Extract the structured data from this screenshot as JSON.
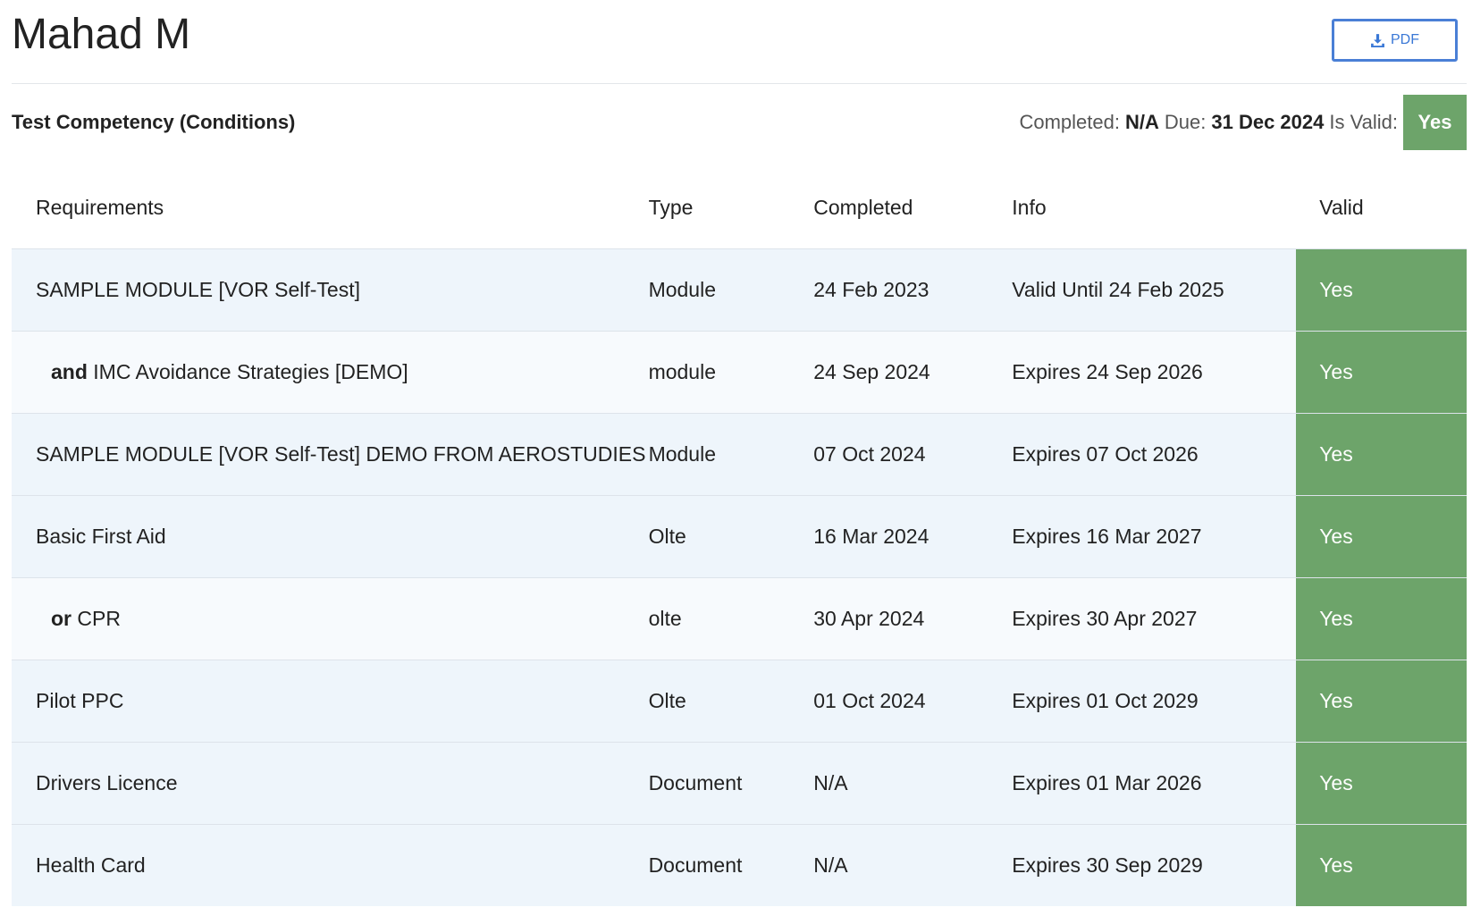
{
  "header": {
    "name": "Mahad M",
    "pdf_label": "PDF"
  },
  "summary": {
    "competency": "Test Competency (Conditions)",
    "completed_label": "Completed:",
    "completed_value": "N/A",
    "due_label": "Due:",
    "due_value": "31 Dec 2024",
    "valid_label": "Is Valid:",
    "valid_value": "Yes"
  },
  "table": {
    "columns": [
      "Requirements",
      "Type",
      "Completed",
      "Info",
      "Valid"
    ],
    "rows": [
      {
        "conj": "",
        "name": "SAMPLE MODULE [VOR Self-Test]",
        "type": "Module",
        "completed": "24 Feb 2023",
        "info": "Valid Until 24 Feb 2025",
        "valid": "Yes"
      },
      {
        "conj": "and",
        "name": "IMC Avoidance Strategies [DEMO]",
        "type": "module",
        "completed": "24 Sep 2024",
        "info": "Expires 24 Sep 2026",
        "valid": "Yes"
      },
      {
        "conj": "",
        "name": "SAMPLE MODULE [VOR Self-Test] DEMO FROM AEROSTUDIES",
        "type": "Module",
        "completed": "07 Oct 2024",
        "info": "Expires 07 Oct 2026",
        "valid": "Yes"
      },
      {
        "conj": "",
        "name": "Basic First Aid",
        "type": "Olte",
        "completed": "16 Mar 2024",
        "info": "Expires 16 Mar 2027",
        "valid": "Yes"
      },
      {
        "conj": "or",
        "name": "CPR",
        "type": "olte",
        "completed": "30 Apr 2024",
        "info": "Expires 30 Apr 2027",
        "valid": "Yes"
      },
      {
        "conj": "",
        "name": "Pilot PPC",
        "type": "Olte",
        "completed": "01 Oct 2024",
        "info": "Expires 01 Oct 2029",
        "valid": "Yes"
      },
      {
        "conj": "",
        "name": "Drivers Licence",
        "type": "Document",
        "completed": "N/A",
        "info": "Expires 01 Mar 2026",
        "valid": "Yes"
      },
      {
        "conj": "",
        "name": "Health Card",
        "type": "Document",
        "completed": "N/A",
        "info": "Expires 30 Sep 2029",
        "valid": "Yes"
      }
    ]
  },
  "colors": {
    "valid_green": "#6da46a",
    "row_odd": "#eef5fb",
    "row_even": "#f7fafd",
    "accent_blue": "#3a78d6"
  },
  "icons": {
    "pdf_button": "download-icon"
  }
}
